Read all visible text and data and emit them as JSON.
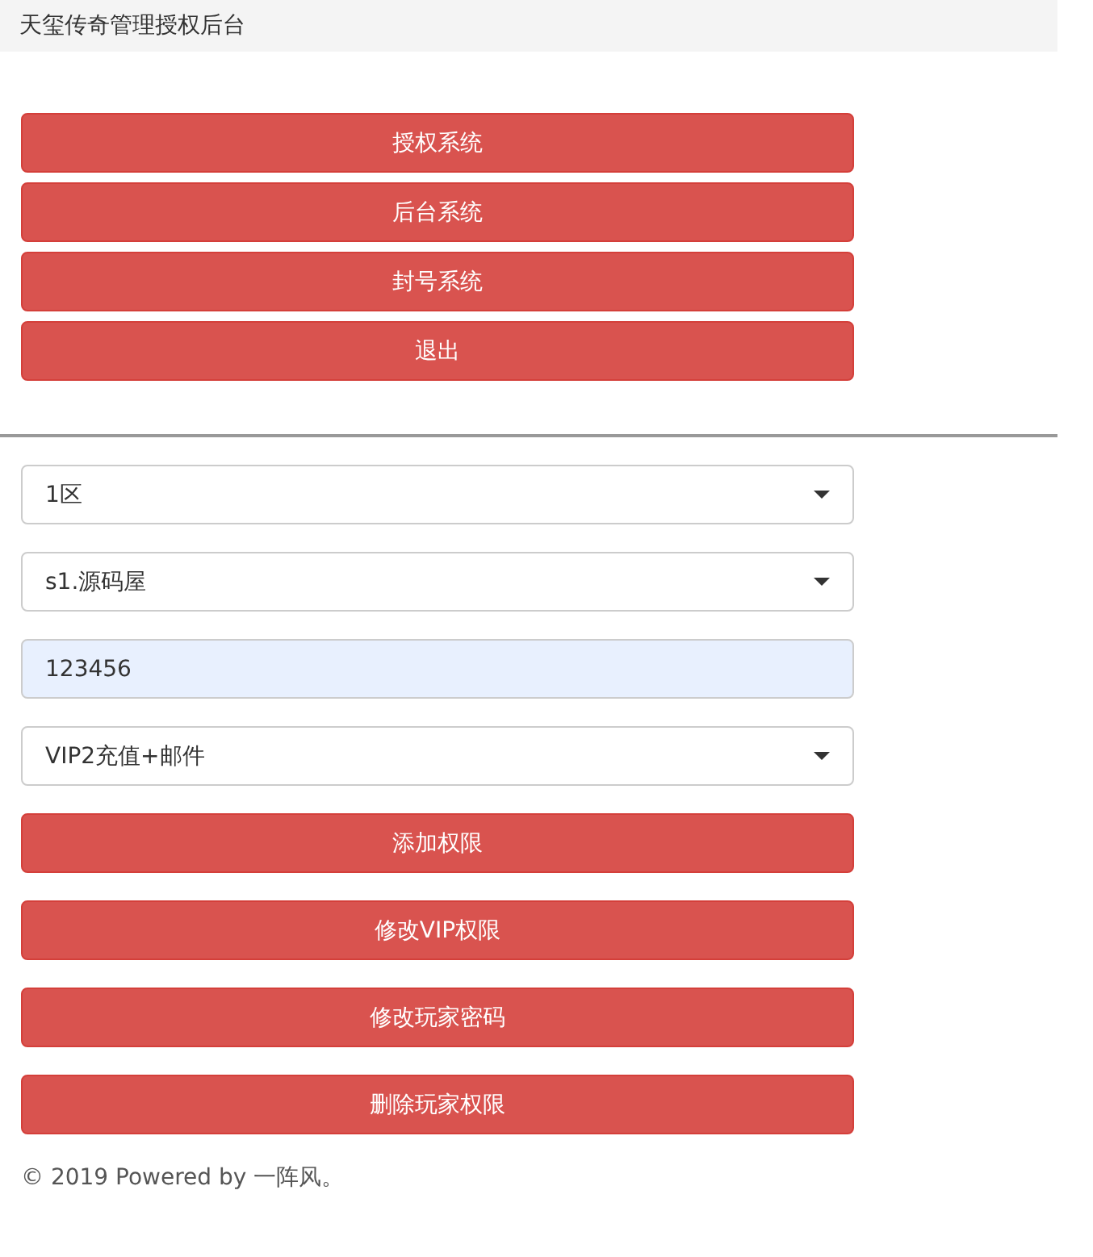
{
  "header": {
    "title": "天玺传奇管理授权后台"
  },
  "nav_buttons": [
    "授权系统",
    "后台系统",
    "封号系统",
    "退出"
  ],
  "form": {
    "fields": [
      {
        "kind": "select",
        "value": "1区"
      },
      {
        "kind": "select",
        "value": "s1.源码屋"
      },
      {
        "kind": "input",
        "value": "123456"
      },
      {
        "kind": "select",
        "value": "VIP2充值+邮件"
      }
    ],
    "buttons": [
      "添加权限",
      "修改VIP权限",
      "修改玩家密码",
      "删除玩家权限"
    ]
  },
  "footer": "© 2019 Powered by 一阵风。"
}
